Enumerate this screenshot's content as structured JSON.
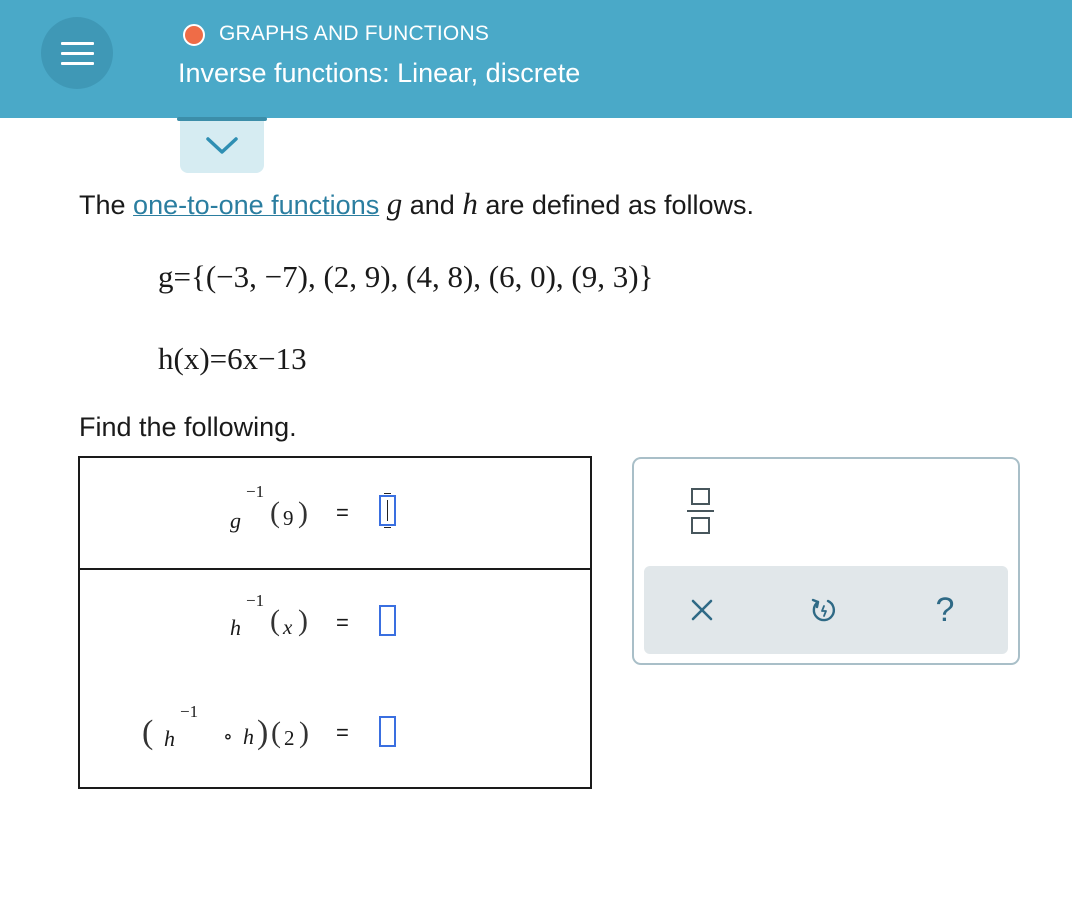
{
  "header": {
    "topic": "GRAPHS AND FUNCTIONS",
    "title": "Inverse functions: Linear, discrete",
    "colors": {
      "bar": "#4aa9c8",
      "topic_dot": "#ef6c47"
    }
  },
  "problem": {
    "intro_prefix": "The",
    "intro_link": "one-to-one functions",
    "var_g": "g",
    "intro_and": "and",
    "var_h": "h",
    "intro_suffix": "are defined as follows.",
    "g_definition": "g={(−3, −7), (2, 9), (4, 8), (6, 0), (9, 3)}",
    "h_definition": "h(x)=6x−13",
    "find_text": "Find the following."
  },
  "answers": [
    {
      "func": "g",
      "inverse_exp": "−1",
      "argument": "9",
      "equals": "=",
      "value": ""
    },
    {
      "func": "h",
      "inverse_exp": "−1",
      "argument": "x",
      "equals": "=",
      "value": ""
    },
    {
      "func_outer": "h",
      "inverse_exp": "−1",
      "compose": "∘",
      "func_inner": "h",
      "argument": "2",
      "equals": "=",
      "value": ""
    }
  ],
  "palette": {
    "buttons": [
      "fraction-icon",
      "clear-icon",
      "undo-icon",
      "help-icon"
    ],
    "help_glyph": "?"
  }
}
